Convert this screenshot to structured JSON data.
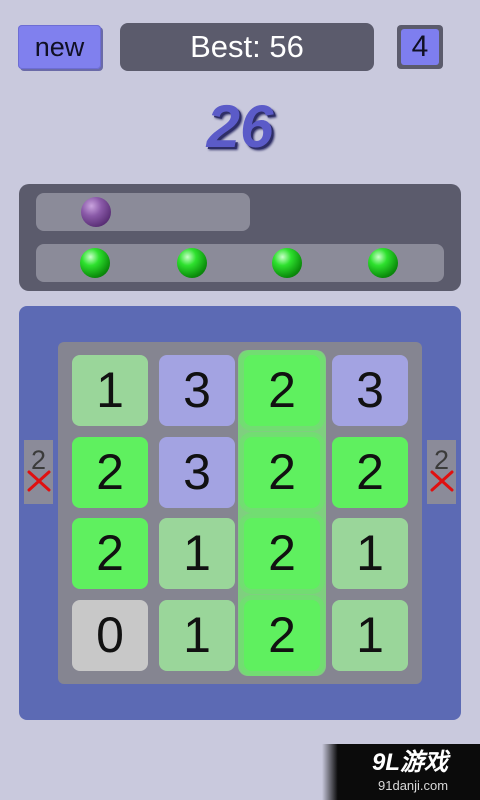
{
  "header": {
    "new_label": "new",
    "best_label": "Best: 56",
    "level": "4"
  },
  "score": "26",
  "tracks": {
    "top_balls": [
      "purple"
    ],
    "bottom_balls": [
      "green",
      "green",
      "green",
      "green"
    ]
  },
  "grid": {
    "rows": [
      [
        "1",
        "3",
        "2",
        "3"
      ],
      [
        "2",
        "3",
        "2",
        "2"
      ],
      [
        "2",
        "1",
        "2",
        "1"
      ],
      [
        "0",
        "1",
        "2",
        "1"
      ]
    ]
  },
  "side": {
    "left": "2",
    "right": "2"
  },
  "watermark": {
    "logo": "9L游戏",
    "url": "91danji.com"
  },
  "colors": {
    "background": "#c9c9dd",
    "button": "#8080ee",
    "panel": "#5b5b6c",
    "board": "#5c6ab4",
    "tile_light_green": "#9ad69a",
    "tile_purple": "#a3a3e2",
    "tile_bright_green": "#5ff05f",
    "tile_grey": "#c8c8c8",
    "score": "#5b5bc8",
    "x_mark": "#e01010"
  }
}
